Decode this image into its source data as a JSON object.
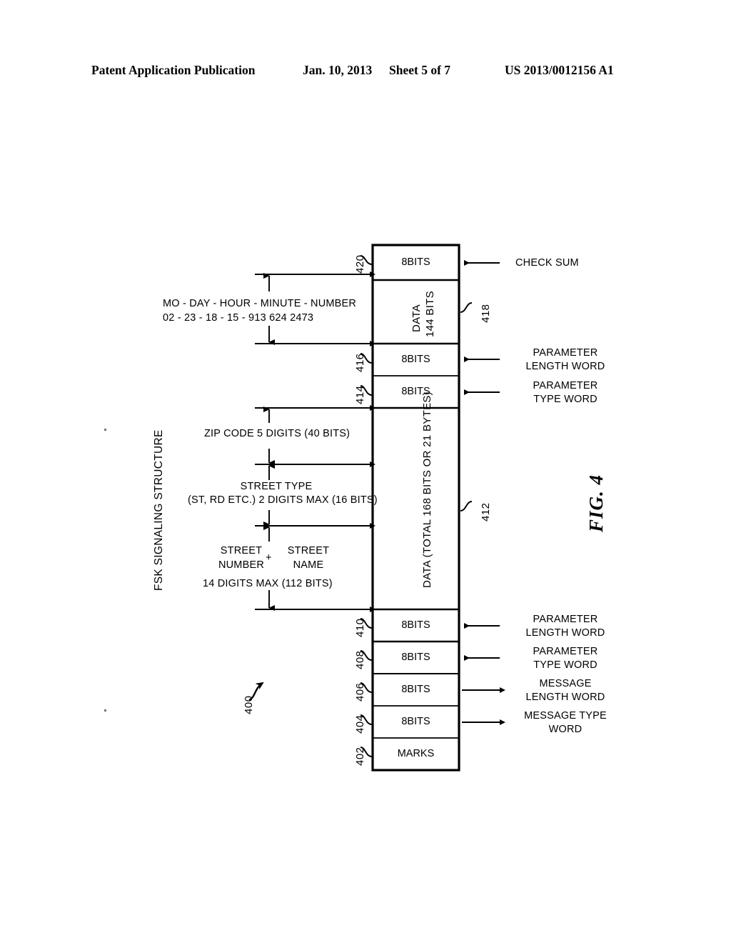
{
  "header": {
    "publication": "Patent Application Publication",
    "date": "Jan. 10, 2013",
    "sheet": "Sheet 5 of 7",
    "number": "US 2013/0012156 A1"
  },
  "figure": {
    "label": "FIG. 4",
    "structure_label": "FSK SIGNALING STRUCTURE",
    "assembly_ref": "400",
    "stack": [
      {
        "ref": "420",
        "cell_text": "8BITS",
        "callout": "CHECK SUM",
        "arrow": "left"
      },
      {
        "ref": "418",
        "cell_text": "DATA 144 BITS",
        "callout": "",
        "arrow": "none"
      },
      {
        "ref": "416",
        "cell_text": "8BITS",
        "callout": "PARAMETER LENGTH WORD",
        "arrow": "left"
      },
      {
        "ref": "414",
        "cell_text": "8BITS",
        "callout": "PARAMETER TYPE WORD",
        "arrow": "left"
      },
      {
        "ref": "412",
        "cell_text": "DATA (TOTAL 168 BITS OR 21 BYTES)",
        "callout": "",
        "arrow": "none"
      },
      {
        "ref": "410",
        "cell_text": "8BITS",
        "callout": "PARAMETER LENGTH WORD",
        "arrow": "left"
      },
      {
        "ref": "408",
        "cell_text": "8BITS",
        "callout": "PARAMETER TYPE WORD",
        "arrow": "left"
      },
      {
        "ref": "406",
        "cell_text": "8BITS",
        "callout": "MESSAGE LENGTH WORD",
        "arrow": "right"
      },
      {
        "ref": "404",
        "cell_text": "8BITS",
        "callout": "MESSAGE TYPE WORD",
        "arrow": "right"
      },
      {
        "ref": "402",
        "cell_text": "MARKS",
        "callout": "",
        "arrow": "none"
      }
    ],
    "cells": {
      "checksum_bits": "8BITS",
      "data_144": "DATA",
      "data_144_bits": "144 BITS",
      "param_len_bits_upper": "8BITS",
      "param_type_bits_upper": "8BITS",
      "data_total": "DATA (TOTAL 168 BITS OR 21 BYTES)",
      "param_len_bits_lower": "8BITS",
      "param_type_bits_lower": "8BITS",
      "msg_len_bits": "8BITS",
      "msg_type_bits": "8BITS",
      "marks": "MARKS"
    },
    "callouts": {
      "check_sum": "CHECK SUM",
      "param_len_upper_1": "PARAMETER",
      "param_len_upper_2": "LENGTH WORD",
      "param_type_upper_1": "PARAMETER",
      "param_type_upper_2": "TYPE WORD",
      "param_len_lower_1": "PARAMETER",
      "param_len_lower_2": "LENGTH WORD",
      "param_type_lower_1": "PARAMETER",
      "param_type_lower_2": "TYPE WORD",
      "msg_len_1": "MESSAGE",
      "msg_len_2": "LENGTH WORD",
      "msg_type_1": "MESSAGE TYPE",
      "msg_type_2": "WORD"
    },
    "refs": {
      "r420": "420",
      "r418": "418",
      "r416": "416",
      "r414": "414",
      "r412": "412",
      "r410": "410",
      "r408": "408",
      "r406": "406",
      "r404": "404",
      "r402": "402",
      "r400": "400"
    },
    "annotations": {
      "timestamp_fields": "MO - DAY - HOUR - MINUTE - NUMBER",
      "timestamp_values": "02 -  23  -  18   -   15  -  913 624 2473",
      "zip_code": "ZIP CODE  5 DIGITS (40 BITS)",
      "street_type_1": "STREET TYPE",
      "street_type_2": "(ST, RD ETC.) 2 DIGITS MAX (16 BITS)",
      "street_number": "STREET\nNUMBER",
      "plus": "+",
      "street_name": "STREET\nNAME",
      "street_digits": "14 DIGITS MAX (112 BITS)"
    }
  }
}
